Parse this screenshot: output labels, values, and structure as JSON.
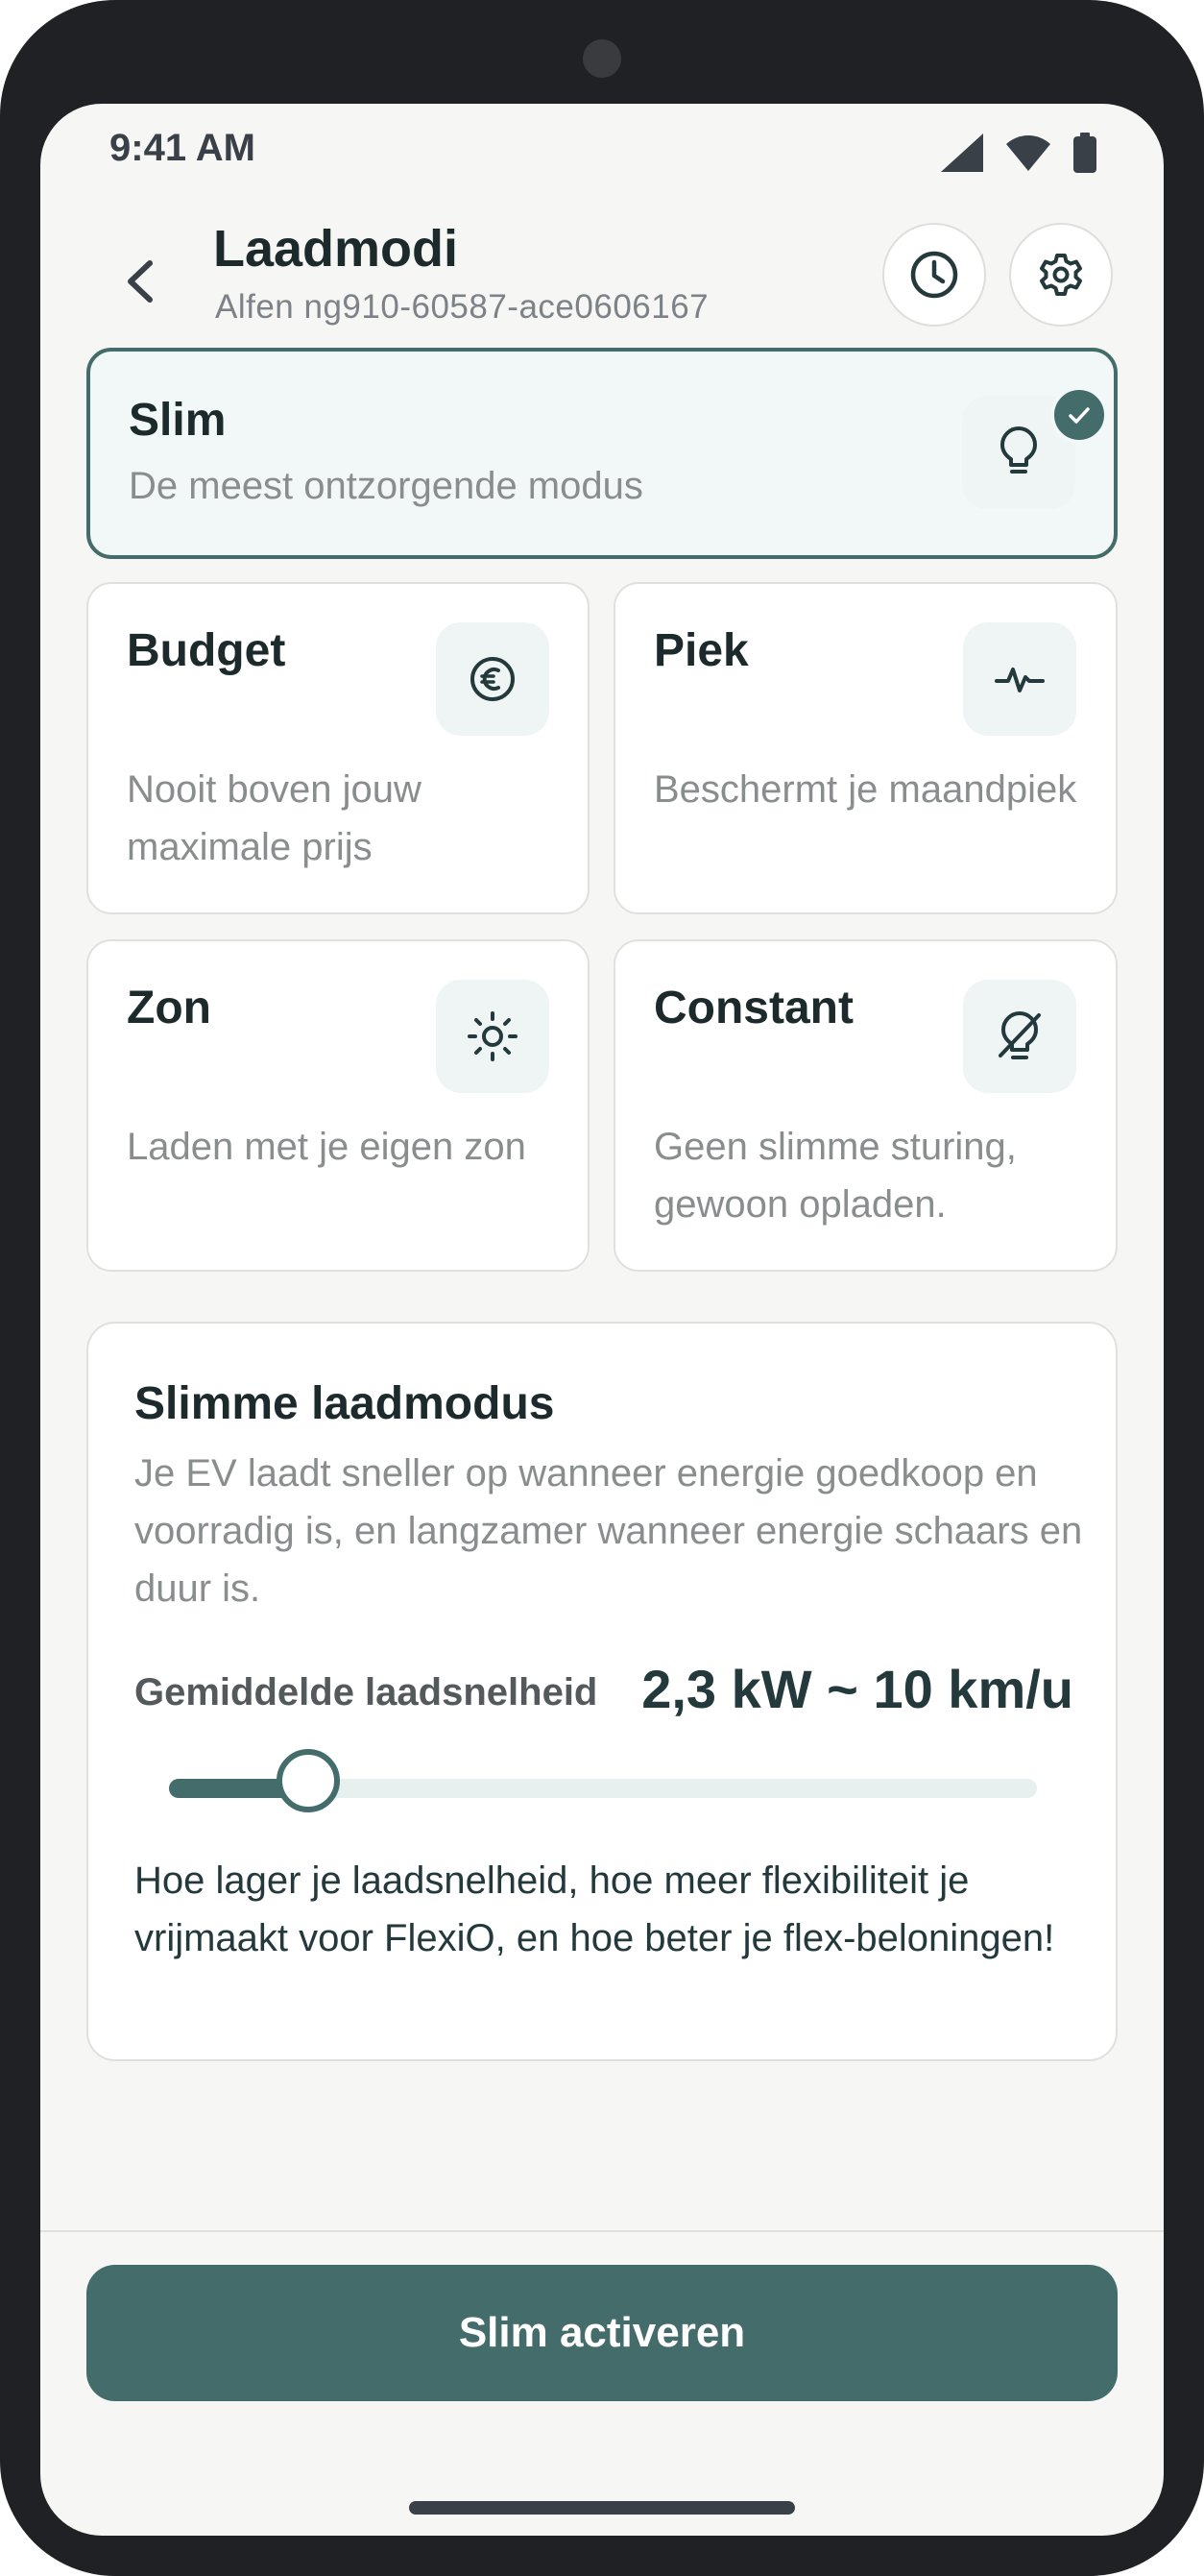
{
  "status_bar": {
    "time": "9:41 AM"
  },
  "header": {
    "title": "Laadmodi",
    "subtitle": "Alfen ng910-60587-ace0606167"
  },
  "modes": [
    {
      "title": "Slim",
      "description": "De meest ontzorgende modus",
      "icon": "lightbulb-icon",
      "selected": true
    },
    {
      "title": "Budget",
      "description": "Nooit boven jouw maximale prijs",
      "icon": "euro-icon",
      "selected": false
    },
    {
      "title": "Piek",
      "description": "Beschermt je maandpiek",
      "icon": "pulse-icon",
      "selected": false
    },
    {
      "title": "Zon",
      "description": "Laden met je eigen zon",
      "icon": "sun-icon",
      "selected": false
    },
    {
      "title": "Constant",
      "description": "Geen slimme sturing, gewoon opladen.",
      "icon": "bulb-off-icon",
      "selected": false
    }
  ],
  "info": {
    "title": "Slimme laadmodus",
    "body": "Je EV laadt sneller op wanneer energie goedkoop en voorradig is, en langzamer wanneer energie schaars en duur is.",
    "speed_label": "Gemiddelde laadsnelheid",
    "speed_value": "2,3 kW ~ 10 km/u",
    "slider_fraction": 0.16,
    "note": "Hoe lager je laadsnelheid, hoe meer flexibiliteit je vrijmaakt voor FlexiO, en hoe beter je flex-beloningen!"
  },
  "cta": {
    "label": "Slim activeren"
  },
  "colors": {
    "accent": "#436c6a",
    "background": "#f6f6f4",
    "selected_card": "#f2f8f7"
  }
}
